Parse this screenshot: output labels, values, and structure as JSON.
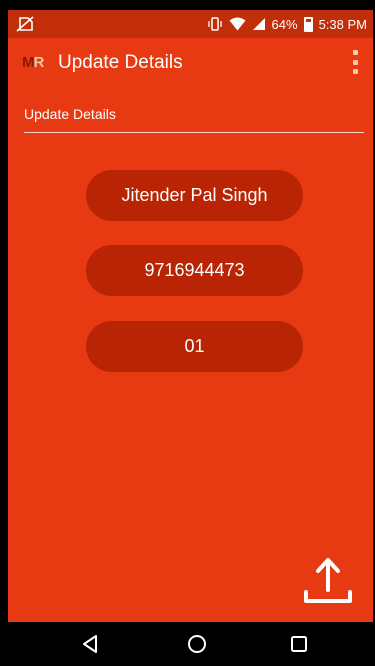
{
  "status_bar": {
    "battery_percent": "64%",
    "time": "5:38 PM",
    "icons": [
      "no-sim-icon",
      "vibrate-icon",
      "wifi-icon",
      "signal-icon",
      "battery-icon"
    ]
  },
  "app_bar": {
    "logo_text_m": "M",
    "logo_text_r": "R",
    "title": "Update Details",
    "overflow_icon": "more-vert-icon"
  },
  "section": {
    "label": "Update Details"
  },
  "fields": {
    "name": "Jitender Pal Singh",
    "phone": "9716944473",
    "code": "01"
  },
  "actions": {
    "upload_icon": "upload-icon"
  },
  "nav": {
    "icons": [
      "back-icon",
      "home-icon",
      "recents-icon"
    ]
  },
  "colors": {
    "background": "#e83a12",
    "pill": "#b82404",
    "status_bar": "#c22d0a"
  }
}
